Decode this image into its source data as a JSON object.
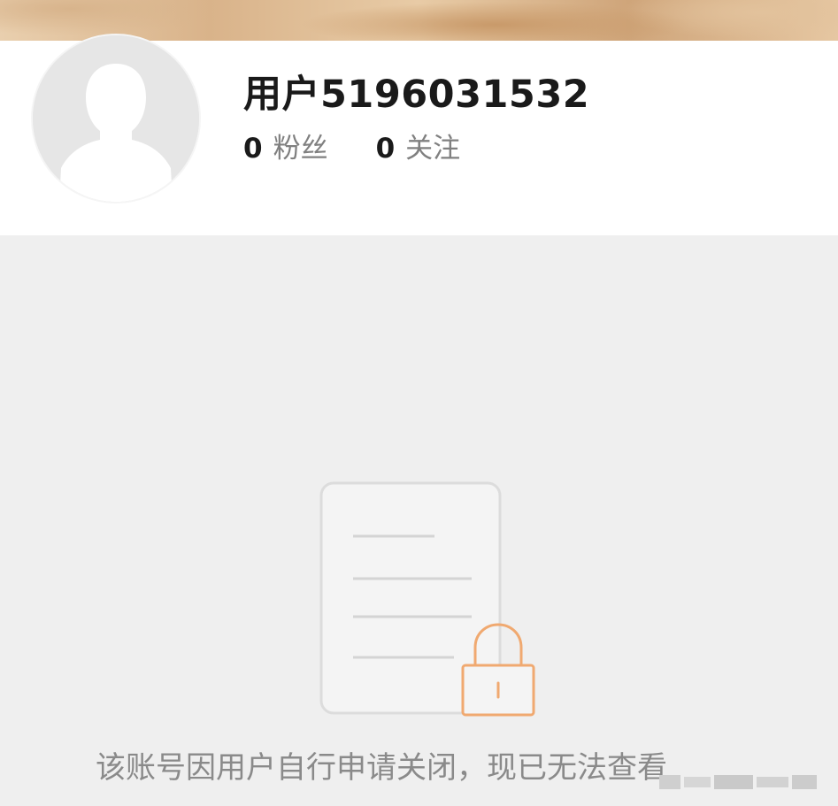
{
  "profile": {
    "username": "用户5196031532",
    "followers": {
      "count": "0",
      "label": "粉丝"
    },
    "following": {
      "count": "0",
      "label": "关注"
    },
    "avatar_icon": "default-avatar-icon"
  },
  "empty_state": {
    "icon": "locked-document-icon",
    "message": "该账号因用户自行申请关闭，现已无法查看"
  },
  "colors": {
    "background": "#efefef",
    "card": "#ffffff",
    "lock_accent": "#f0a970",
    "text_primary": "#1a1a1a",
    "text_secondary": "#808080"
  }
}
